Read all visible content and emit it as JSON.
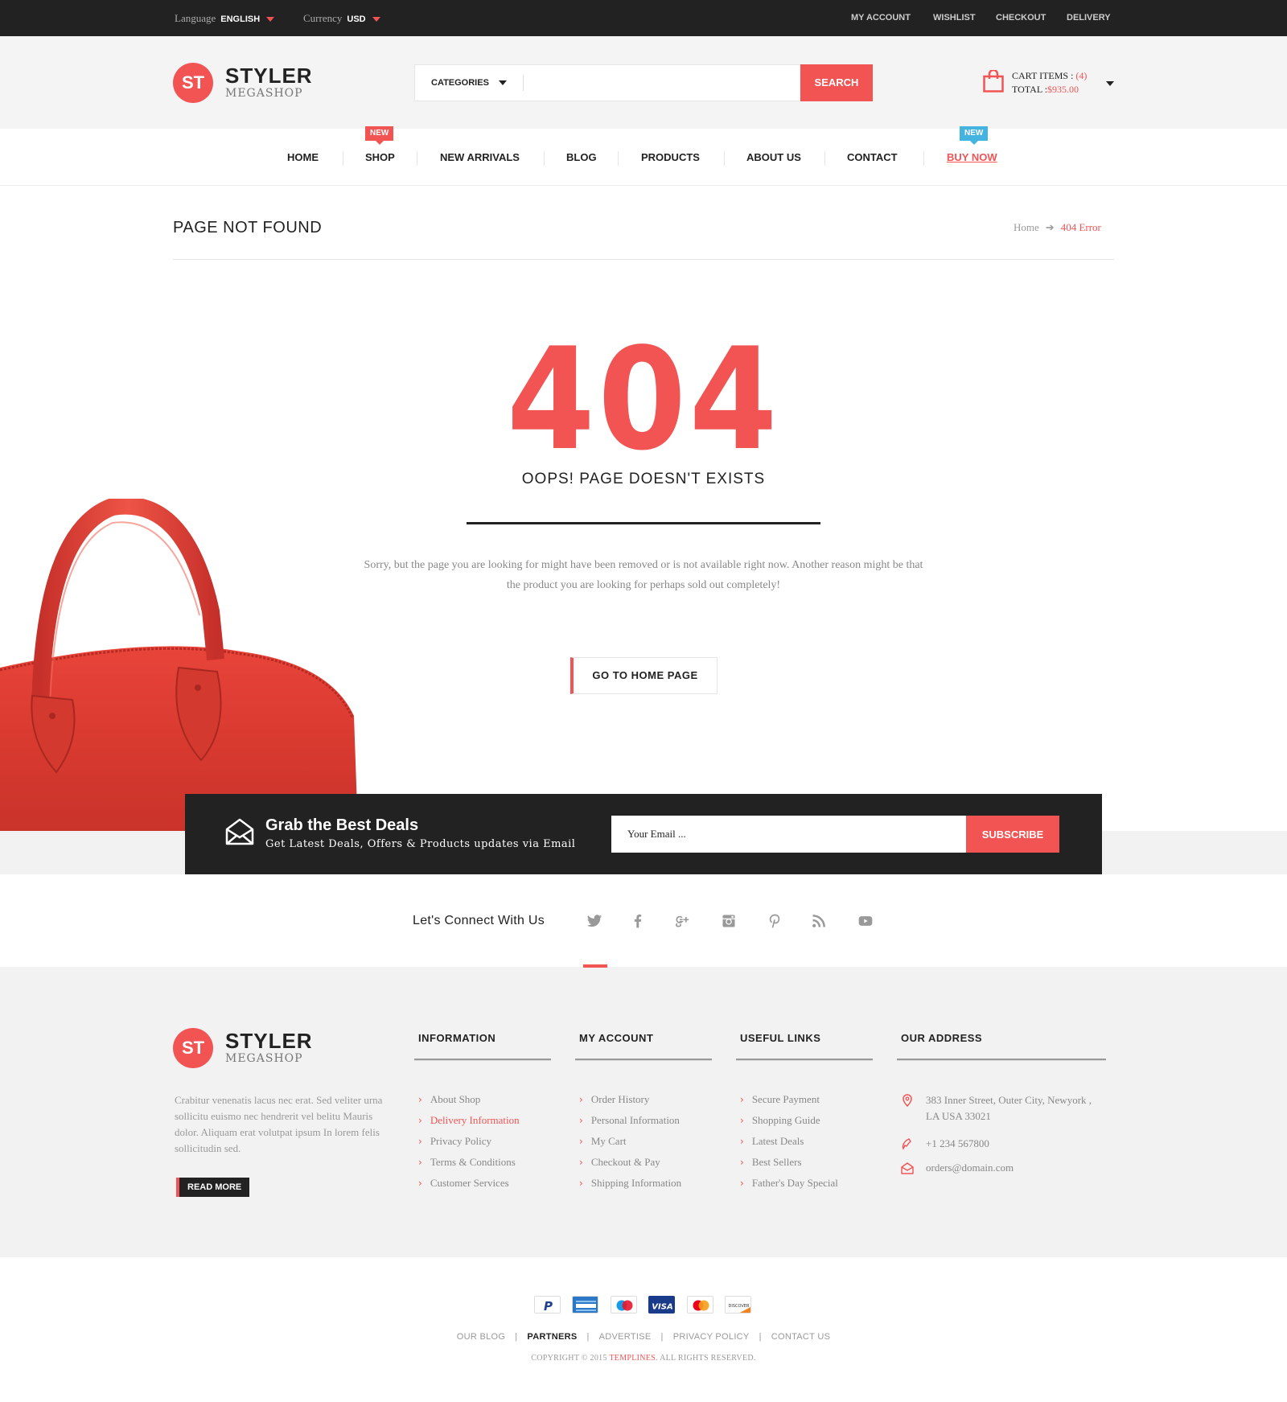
{
  "topbar": {
    "language_label": "Language",
    "language_value": "ENGLISH",
    "currency_label": "Currency",
    "currency_value": "USD",
    "links": [
      "MY ACCOUNT",
      "WISHLIST",
      "CHECKOUT",
      "DELIVERY"
    ]
  },
  "brand": {
    "mark": "ST",
    "name": "STYLER",
    "sub": "MEGASHOP"
  },
  "search": {
    "category": "CATEGORIES",
    "placeholder": "",
    "button": "SEARCH"
  },
  "cart": {
    "items_label": "CART ITEMS :",
    "items_count": "(4)",
    "total_label": "TOTAL :",
    "total_value": "$935.00"
  },
  "nav": {
    "items": [
      "HOME",
      "SHOP",
      "NEW ARRIVALS",
      "BLOG",
      "PRODUCTS",
      "ABOUT US",
      "CONTACT",
      "BUY NOW"
    ],
    "badge_shop": "NEW",
    "badge_buy": "NEW"
  },
  "page": {
    "title": "PAGE NOT FOUND",
    "crumb_home": "Home",
    "crumb_current": "404 Error"
  },
  "error": {
    "code": "404",
    "headline": "OOPS! PAGE DOESN'T EXISTS",
    "message": "Sorry, but the page you are looking for might have been removed or is not available right now. Another reason might be that the product you are looking for perhaps sold out completely!",
    "button": "GO TO HOME PAGE"
  },
  "newsletter": {
    "title": "Grab the Best Deals",
    "subtitle": "Get Latest Deals, Offers & Products updates via Email",
    "placeholder": "Your Email ...",
    "button": "SUBSCRIBE"
  },
  "connect": {
    "title": "Let's Connect With Us",
    "icons": [
      "twitter-icon",
      "facebook-icon",
      "google-plus-icon",
      "instagram-icon",
      "pinterest-icon",
      "rss-icon",
      "youtube-icon"
    ]
  },
  "footer": {
    "description": "Crabitur venenatis lacus nec erat. Sed veliter urna sollicitu euismo nec hendrerit vel belitu Mauris dolor. Aliquam erat volutpat ipsum In lorem felis sollicitudin sed.",
    "read_more": "READ MORE",
    "information": {
      "title": "INFORMATION",
      "links": [
        "About Shop",
        "Delivery Information",
        "Privacy Policy",
        "Terms & Conditions",
        "Customer Services"
      ]
    },
    "my_account": {
      "title": "MY ACCOUNT",
      "links": [
        "Order History",
        "Personal Information",
        "My Cart",
        "Checkout & Pay",
        "Shipping Information"
      ]
    },
    "useful_links": {
      "title": "USEFUL LINKS",
      "links": [
        "Secure Payment",
        "Shopping Guide",
        "Latest Deals",
        "Best Sellers",
        "Father's Day Special"
      ]
    },
    "address": {
      "title": "OUR ADDRESS",
      "line1": "383 Inner Street, Outer City, Newyork ,",
      "line2": "LA USA 33021",
      "phone": "+1 234 567800",
      "email": "orders@domain.com"
    }
  },
  "bottom": {
    "payment_icons": [
      "paypal-icon",
      "amex-icon",
      "maestro-icon",
      "visa-icon",
      "mastercard-icon",
      "discover-icon"
    ],
    "visa_text": "VISA",
    "discover_text": "DISCOVER",
    "links": [
      "OUR BLOG",
      "PARTNERS",
      "ADVERTISE",
      "PRIVACY POLICY",
      "CONTACT US"
    ],
    "copyright_pre": "COPYRIGHT © 2015 ",
    "copyright_brand": "TEMPLINES",
    "copyright_post": ". ALL RIGHTS RESERVED."
  },
  "colors": {
    "accent": "#f25454",
    "dark": "#222222",
    "badge_blue": "#45b3e0"
  }
}
